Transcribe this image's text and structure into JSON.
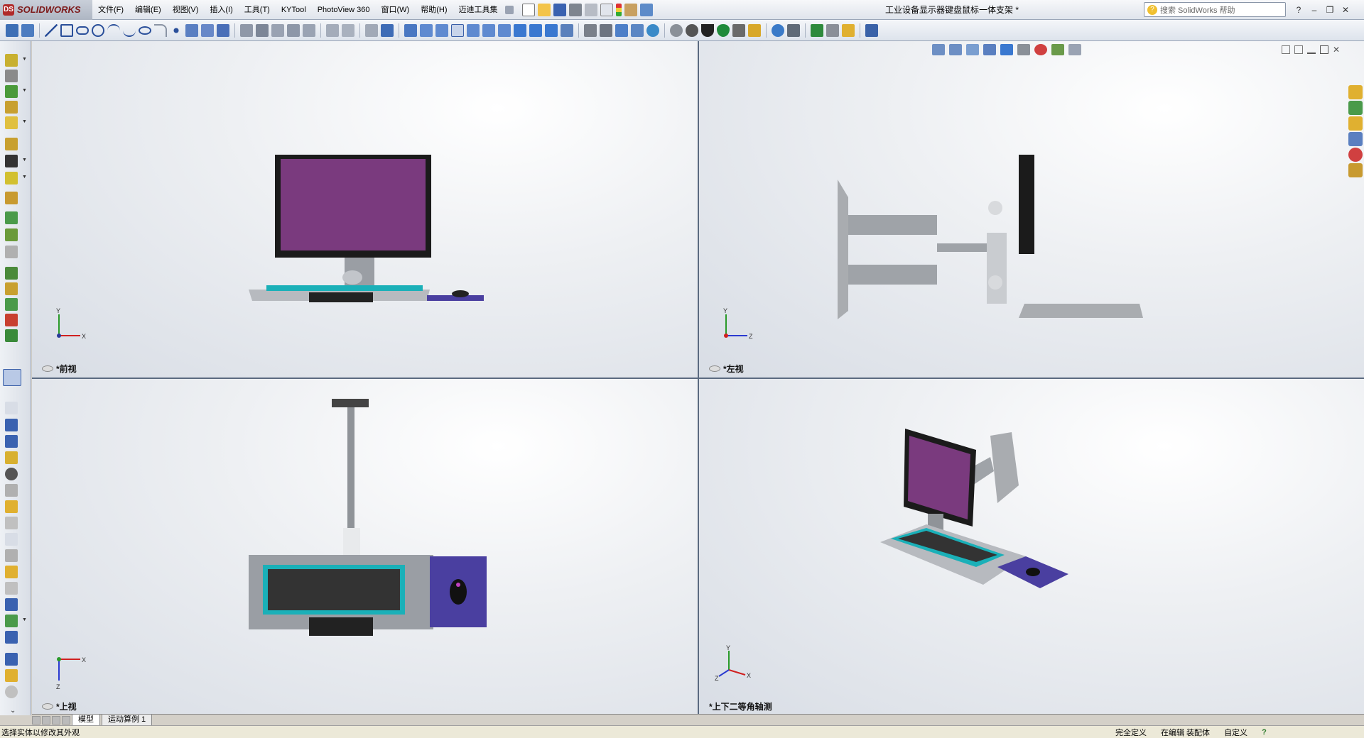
{
  "app": {
    "logo_text": "SOLIDWORKS",
    "logo_badge": "DS",
    "document_title": "工业设备显示器键盘鼠标一体支架 *"
  },
  "menu": {
    "items": [
      "文件(F)",
      "编辑(E)",
      "视图(V)",
      "插入(I)",
      "工具(T)",
      "KYTool",
      "PhotoView 360",
      "窗口(W)",
      "帮助(H)",
      "迈迪工具集"
    ]
  },
  "search": {
    "placeholder": "搜索 SolidWorks 帮助"
  },
  "window_controls": [
    "?",
    "–",
    "❐",
    "✕"
  ],
  "viewports": [
    {
      "name": "front",
      "label": "*前视",
      "axes": [
        "Y",
        "X"
      ]
    },
    {
      "name": "left",
      "label": "*左视",
      "axes": [
        "Y",
        "Z"
      ]
    },
    {
      "name": "top",
      "label": "*上视",
      "axes": [
        "X",
        "Z"
      ]
    },
    {
      "name": "iso",
      "label": "*上下二等角轴测",
      "axes": [
        "Y",
        "X",
        "Z"
      ]
    }
  ],
  "tabs": [
    {
      "label": "模型",
      "active": true
    },
    {
      "label": "运动算例 1",
      "active": false
    }
  ],
  "status": {
    "hint": "选择实体以修改其外观",
    "definition": "完全定义",
    "editing": "在编辑 装配体",
    "units": "自定义",
    "help": "?"
  },
  "colors": {
    "screen": "#7a3a7e",
    "keyboard_accent": "#1ab0b8",
    "mousepad": "#4a3fa0",
    "frame": "#1b1b1b",
    "metal": "#a9acb0"
  }
}
